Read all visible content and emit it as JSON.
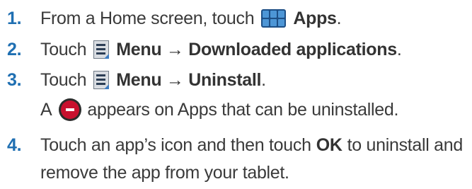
{
  "steps": [
    {
      "number": "1.",
      "before": "From a Home screen, touch",
      "icon": "apps-grid-icon",
      "bold": "Apps",
      "after": "."
    },
    {
      "number": "2.",
      "before": "Touch",
      "icon": "menu-icon",
      "bold": "Menu → Downloaded applications",
      "after": "."
    },
    {
      "number": "3.",
      "before": "Touch",
      "icon": "menu-icon",
      "bold": "Menu → Uninstall",
      "after": "."
    },
    {
      "number": "",
      "before": "A",
      "icon": "remove-minus-icon",
      "after": "appears on Apps that can be uninstalled."
    },
    {
      "number": "4.",
      "before": "Touch an app’s icon and then touch",
      "bold": "OK",
      "after": "to uninstall and",
      "continuation": "remove the app from your tablet."
    }
  ],
  "colors": {
    "step_number": "#1f6fb2",
    "body_text": "#3a3a3a",
    "remove_icon": "#c8102e"
  }
}
